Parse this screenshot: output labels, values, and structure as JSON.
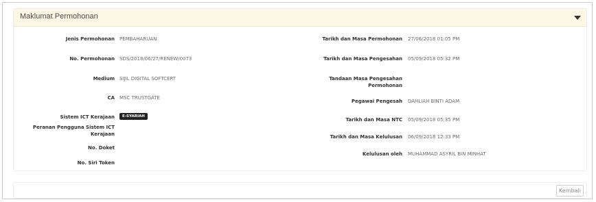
{
  "panel": {
    "title": "Maklumat Permohonan",
    "toggle_icon": "caret-down-icon"
  },
  "left": {
    "jenis_label": "Jenis Permohonan",
    "jenis_value": "PEMBAHARUAN",
    "no_label": "No. Permohonan",
    "no_value": "SDS/2018/06/27/RENEW/0073",
    "medium_label": "Medium",
    "medium_value": "SIJIL DIGITAL SOFTCERT",
    "ca_label": "CA",
    "ca_value": "MSC TRUSTGATE",
    "sistem_label": "Sistem ICT Kerajaan",
    "sistem_badge": "E-SYARIAH",
    "peranan_label_1": "Peranan Pengguna Sistem ICT",
    "peranan_label_2": "Kerajaan",
    "doket_label": "No. Doket",
    "siri_label": "No. Siri Token"
  },
  "right": {
    "tarikh_mohon_label": "Tarikh dan Masa Permohonan",
    "tarikh_mohon_value": "27/06/2018 01:05 PM",
    "tarikh_sah_label": "Tarikh dan Masa Pengesahan",
    "tarikh_sah_value": "05/09/2018 05:32 PM",
    "tandaan_label_1": "Tandaan Masa Pengesahan",
    "tandaan_label_2": "Permohonan",
    "pegawai_label": "Pegawai Pengesah",
    "pegawai_value": "DAHLIAH BINTI ADAM",
    "ntc_label": "Tarikh dan Masa NTC",
    "ntc_value": "05/09/2018 05:35 PM",
    "lulus_label": "Tarikh dan Masa Kelulusan",
    "lulus_value": "06/09/2018 12:33 PM",
    "oleh_label": "Kelulusan oleh",
    "oleh_value": "MUHAMMAD ASYRIL BIN MINHAT"
  },
  "footer": {
    "back_label": "Kembali"
  }
}
